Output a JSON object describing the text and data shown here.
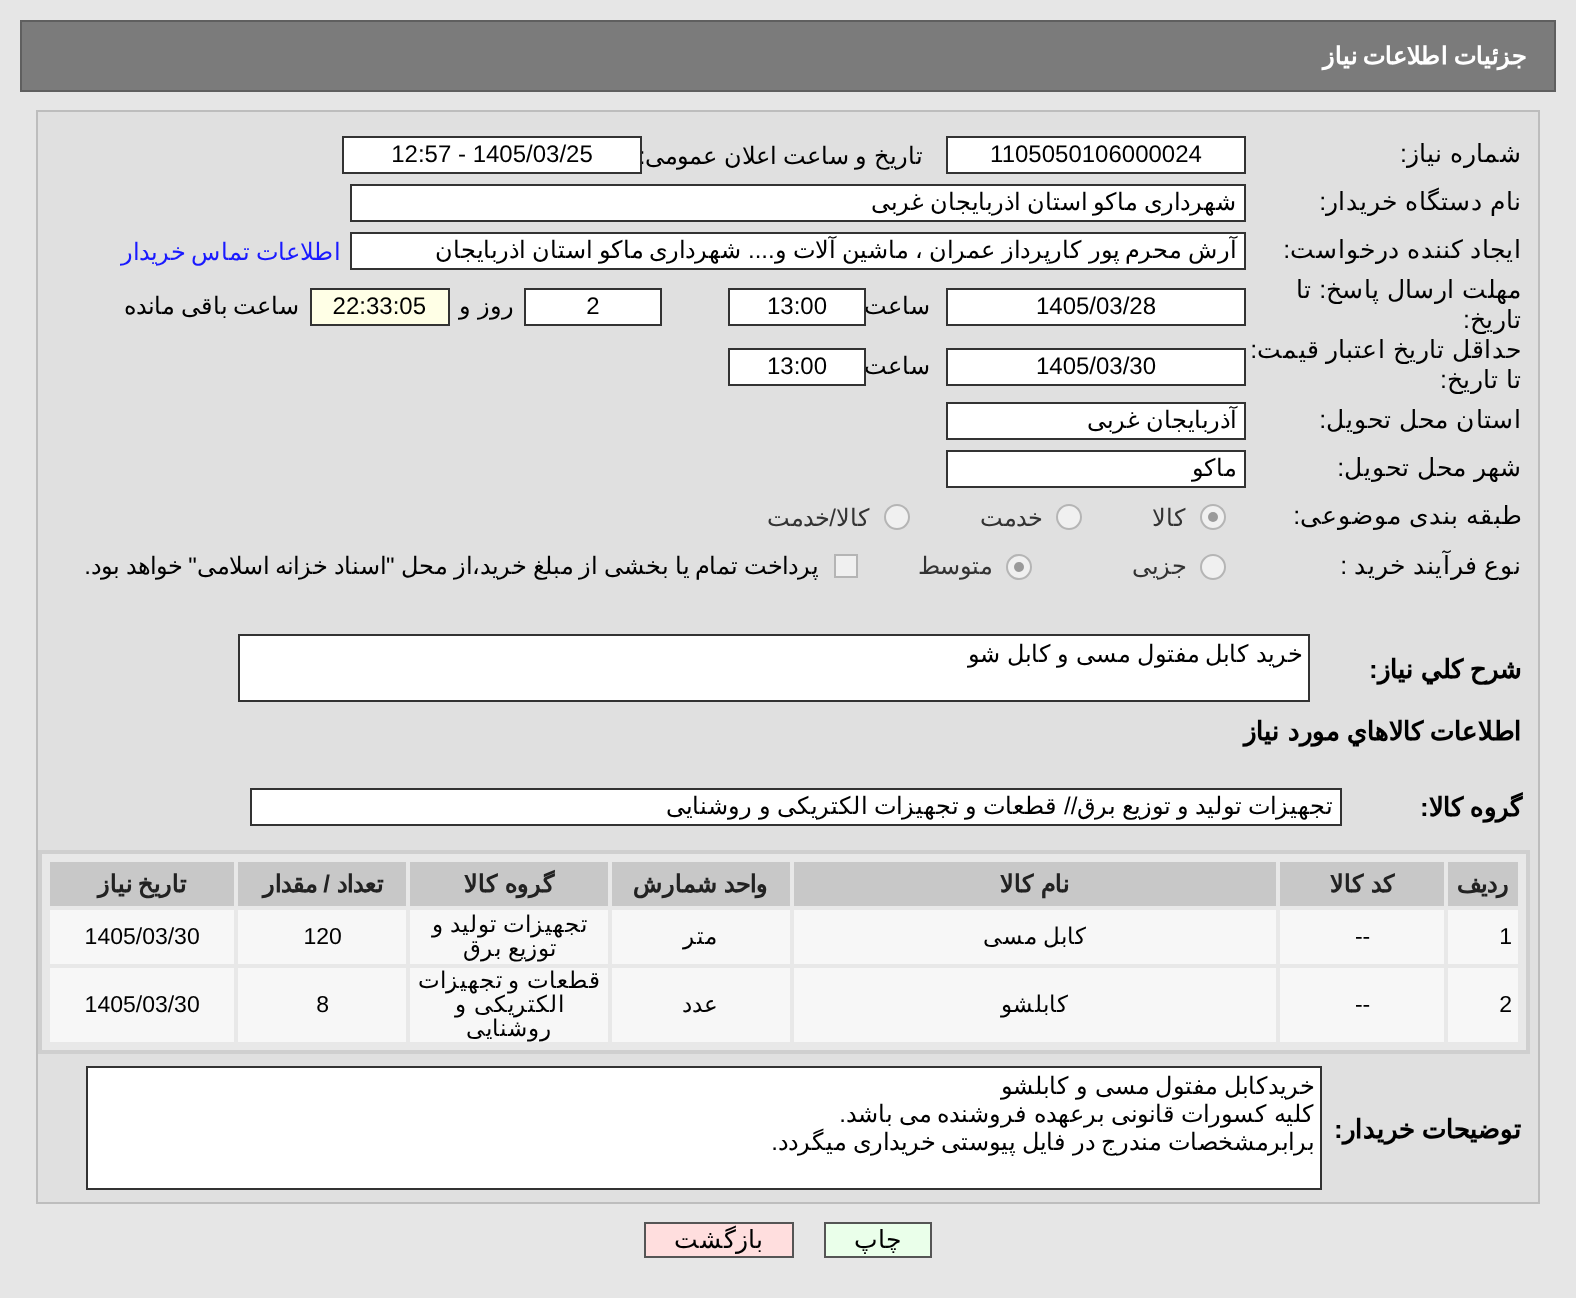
{
  "header": {
    "title": "جزئیات اطلاعات نیاز"
  },
  "need_number": {
    "label": "شماره نیاز:",
    "value": "1105050106000024"
  },
  "announce": {
    "label": "تاریخ و ساعت اعلان عمومی:",
    "value": "1405/03/25 - 12:57"
  },
  "buyer_org": {
    "label": "نام دستگاه خریدار:",
    "value": "شهرداری ماکو استان اذربایجان غربی"
  },
  "requester": {
    "label": "ایجاد کننده درخواست:",
    "value": "آرش محرم پور کارپرداز عمران ، ماشین آلات و.... شهرداری ماکو استان اذربایجان",
    "link": "اطلاعات تماس خریدار"
  },
  "reply_deadline": {
    "label": "مهلت ارسال پاسخ: تا تاریخ:",
    "date": "1405/03/28",
    "time_label": "ساعت",
    "time": "13:00",
    "days": "2",
    "days_label": "روز و",
    "remaining": "22:33:05",
    "remaining_label": "ساعت باقی مانده"
  },
  "price_validity": {
    "label": "حداقل تاریخ اعتبار قیمت: تا تاریخ:",
    "date": "1405/03/30",
    "time_label": "ساعت",
    "time": "13:00"
  },
  "province": {
    "label": "استان محل تحویل:",
    "value": "آذربایجان غربی"
  },
  "city": {
    "label": "شهر محل تحویل:",
    "value": "ماکو"
  },
  "category": {
    "label": "طبقه بندی موضوعی:",
    "options": [
      {
        "label": "کالا",
        "selected": true
      },
      {
        "label": "خدمت",
        "selected": false
      },
      {
        "label": "کالا/خدمت",
        "selected": false
      }
    ]
  },
  "process": {
    "label": "نوع فرآیند خرید :",
    "options": [
      {
        "label": "جزیی",
        "selected": false
      },
      {
        "label": "متوسط",
        "selected": true
      }
    ],
    "treasury": {
      "label": "پرداخت تمام یا بخشی از مبلغ خرید،از محل \"اسناد خزانه اسلامی\" خواهد بود.",
      "checked": false
    }
  },
  "description": {
    "label": "شرح کلي نياز:",
    "value": "خرید کابل مفتول مسی و کابل شو"
  },
  "goods_section": {
    "title": "اطلاعات کالاهاي مورد نياز"
  },
  "goods_group": {
    "label": "گروه کالا:",
    "value": "تجهیزات تولید و توزیع برق// قطعات و تجهیزات الکتریکی و روشنایی"
  },
  "table": {
    "columns": [
      "ردیف",
      "کد کالا",
      "نام کالا",
      "واحد شمارش",
      "گروه کالا",
      "تعداد / مقدار",
      "تاریخ نیاز"
    ],
    "rows": [
      [
        "1",
        "--",
        "کابل مسی",
        "متر",
        "تجهیزات تولید و توزیع برق",
        "120",
        "1405/03/30"
      ],
      [
        "2",
        "--",
        "کابلشو",
        "عدد",
        "قطعات و تجهیزات الکتریکی و روشنایی",
        "8",
        "1405/03/30"
      ]
    ]
  },
  "buyer_notes": {
    "label": "توضیحات خریدار:",
    "lines": [
      "خریدکابل مفتول مسی و کابلشو",
      "کلیه کسورات قانونی برعهده فروشنده می باشد.",
      "برابرمشخصات مندرج در فایل پیوستی خریداری میگردد."
    ]
  },
  "buttons": [
    {
      "label": "چاپ",
      "kind": "print"
    },
    {
      "label": "بازگشت",
      "kind": "back"
    }
  ]
}
